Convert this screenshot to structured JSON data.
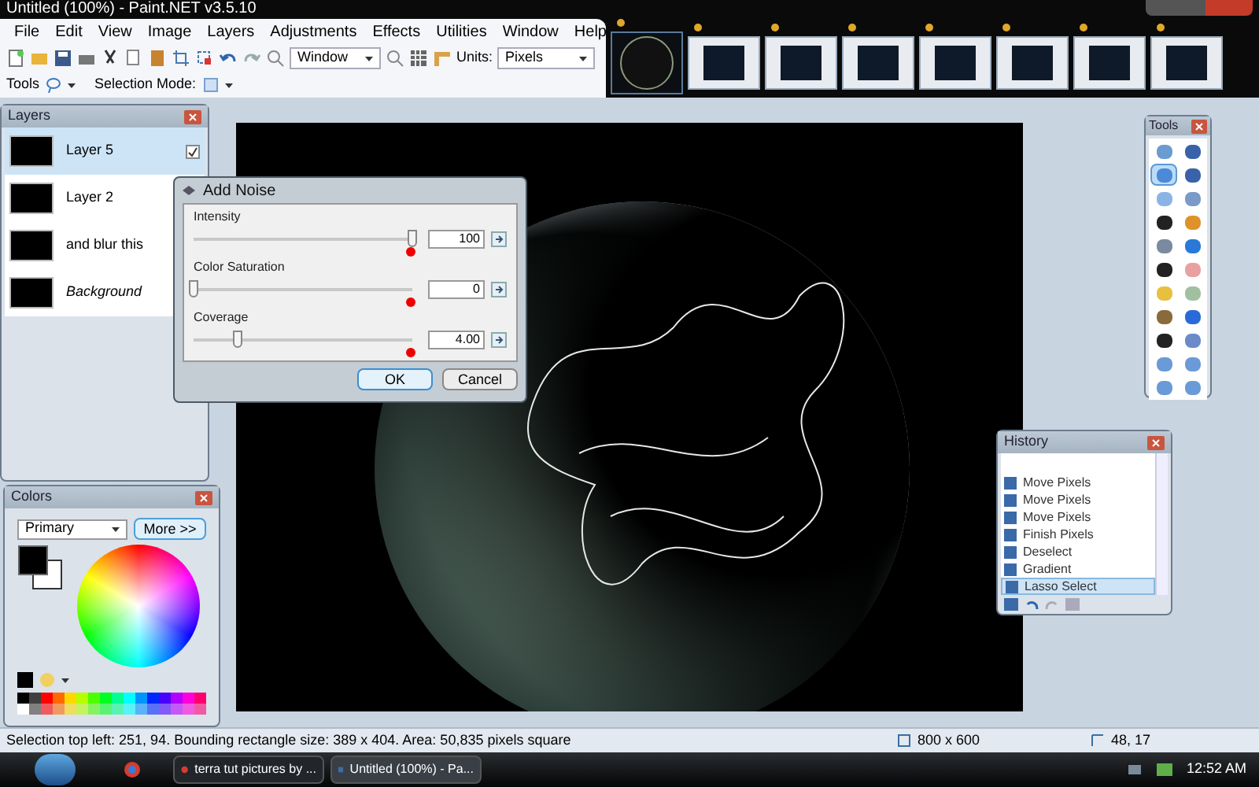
{
  "window": {
    "title": "Untitled (100%) - Paint.NET v3.5.10"
  },
  "menu": [
    "File",
    "Edit",
    "View",
    "Image",
    "Layers",
    "Adjustments",
    "Effects",
    "Utilities",
    "Window",
    "Help"
  ],
  "toolbar": {
    "zoom": "Window",
    "units_label": "Units:",
    "units": "Pixels",
    "tools_label": "Tools",
    "selection_mode_label": "Selection Mode:"
  },
  "thumbnails": [
    {
      "selected": true
    },
    {
      "selected": false
    },
    {
      "selected": false
    },
    {
      "selected": false
    },
    {
      "selected": false
    },
    {
      "selected": false
    },
    {
      "selected": false
    },
    {
      "selected": false
    }
  ],
  "layers": {
    "title": "Layers",
    "items": [
      {
        "name": "Layer 5",
        "kind": "layer",
        "selected": true
      },
      {
        "name": "Layer 2",
        "kind": "layer",
        "selected": false
      },
      {
        "name": "and blur this",
        "kind": "layer",
        "selected": false
      },
      {
        "name": "Background",
        "kind": "background",
        "selected": false
      }
    ]
  },
  "add_noise": {
    "title": "Add Noise",
    "sliders": [
      {
        "label": "Intensity",
        "value": "100",
        "level": 1
      },
      {
        "label": "Color Saturation",
        "value": "0",
        "level": 0
      },
      {
        "label": "Coverage",
        "value": "4.00",
        "level": 0.2
      }
    ],
    "buttons": [
      "OK",
      "Cancel"
    ]
  },
  "colors": {
    "title": "Colors",
    "mode": "Primary",
    "more": "More >>"
  },
  "tools": {
    "title": "Tools",
    "items": [
      {
        "selected": false
      },
      {
        "selected": false
      },
      {
        "selected": true
      },
      {
        "selected": false
      },
      {
        "selected": false
      },
      {
        "selected": false
      },
      {
        "selected": false
      },
      {
        "selected": false
      },
      {
        "selected": false
      },
      {
        "selected": false
      },
      {
        "selected": false
      },
      {
        "selected": false
      },
      {
        "selected": false
      },
      {
        "selected": false
      },
      {
        "selected": false
      },
      {
        "selected": false
      },
      {
        "selected": false
      },
      {
        "selected": false
      },
      {
        "selected": false
      },
      {
        "selected": false
      },
      {
        "selected": false
      },
      {
        "selected": false
      }
    ]
  },
  "history": {
    "title": "History",
    "items": [
      {
        "name": "Move Pixels",
        "selected": false
      },
      {
        "name": "Move Pixels",
        "selected": false
      },
      {
        "name": "Move Pixels",
        "selected": false
      },
      {
        "name": "Finish Pixels",
        "selected": false
      },
      {
        "name": "Deselect",
        "selected": false
      },
      {
        "name": "Gradient",
        "selected": false
      },
      {
        "name": "Lasso Select",
        "selected": true
      }
    ]
  },
  "status_bar": {
    "text": "Selection top left: 251, 94. Bounding rectangle size: 389 x 404. Area: 50,835 pixels square",
    "size": "800 x 600",
    "position": "48, 17"
  },
  "taskbar": {
    "tasks": [
      "terra tut pictures by ...",
      "Untitled (100%) - Pa..."
    ],
    "clock": "12:52 AM"
  }
}
